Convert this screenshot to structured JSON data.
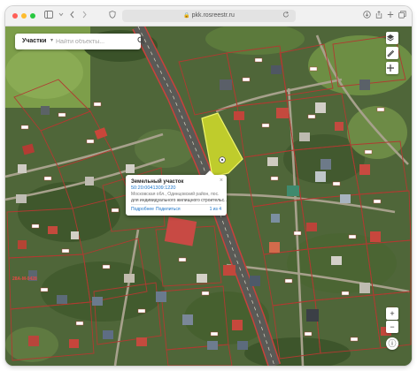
{
  "window": {
    "traffic_light_colors": {
      "close": "#ff5f57",
      "minimize": "#febc2e",
      "maximize": "#28c840"
    },
    "address": "pkk.rosreestr.ru",
    "toolbar_icons": [
      "sidebar-icon",
      "chevron-left-icon",
      "chevron-right-icon",
      "shield-icon",
      "lock-icon",
      "reload-icon",
      "download-icon",
      "share-icon",
      "new-tab-icon",
      "tabs-icon"
    ]
  },
  "search": {
    "category": "Участки",
    "placeholder": "Найти объекты...",
    "value": ""
  },
  "map_controls": {
    "top": [
      "layers-icon",
      "ruler-icon",
      "select-icon"
    ],
    "zoom_in": "+",
    "zoom_out": "−",
    "info": "ⓘ"
  },
  "popup": {
    "title": "Земельный участок",
    "cadastral_number": "50:20:0041309:1220",
    "address": "Московская обл., Одинцовский район, пос.",
    "use": "для индивидуального жилищного строительс...",
    "details_link": "Подробнее",
    "share_link": "Поделиться",
    "pages": "1 из 4"
  },
  "map_labels": {
    "road": "28А-М-0428"
  },
  "colors": {
    "parcel_border": "#b13a31",
    "selected_parcel": "#d8e32a",
    "road_asphalt": "#5a5a56",
    "road_border": "#c9413c",
    "link": "#1a73c8"
  }
}
